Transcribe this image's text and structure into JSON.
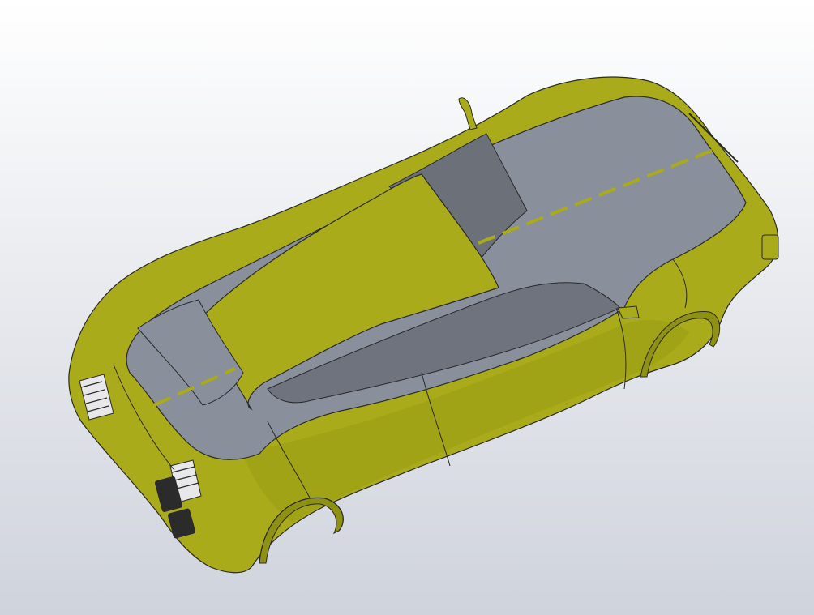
{
  "viewport": {
    "background_top": "#ffffff",
    "background_bottom": "#cfd3dc"
  },
  "model": {
    "body_color": "#a9ab1a",
    "body_shadow_color": "#8f9112",
    "glass_color": "#8a8f9c",
    "glass_dark_color": "#6c7079",
    "edge_color": "#2a2a2a",
    "grille_color": "#e8e8ea",
    "tire_color": "#2b2b2b"
  }
}
